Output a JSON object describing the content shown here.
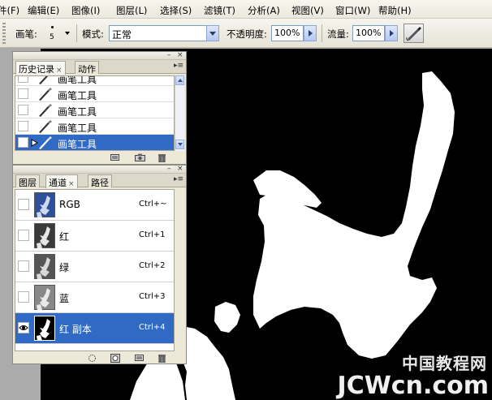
{
  "menu": {
    "items": [
      "件(F)",
      "编辑(E)",
      "图像(I)",
      "图层(L)",
      "选择(S)",
      "滤镜(T)",
      "分析(A)",
      "视图(V)",
      "窗口(W)",
      "帮助(H)"
    ]
  },
  "options": {
    "brush_label": "画笔:",
    "brush_size": "5",
    "mode_label": "模式:",
    "mode_value": "正常",
    "opacity_label": "不透明度:",
    "opacity_value": "100%",
    "flow_label": "流量:",
    "flow_value": "100%",
    "airbrush_icon": "airbrush-icon"
  },
  "history_panel": {
    "tabs": [
      "历史记录",
      "动作"
    ],
    "close_mark": "×",
    "items": [
      {
        "label": "画笔工具",
        "selected": false
      },
      {
        "label": "画笔工具",
        "selected": false
      },
      {
        "label": "画笔工具",
        "selected": false
      },
      {
        "label": "画笔工具",
        "selected": false
      },
      {
        "label": "画笔工具",
        "selected": true
      }
    ]
  },
  "channels_panel": {
    "tabs": [
      "图层",
      "通道",
      "路径"
    ],
    "close_mark": "×",
    "channels": [
      {
        "name": "RGB",
        "shortcut": "Ctrl+~",
        "visible": false,
        "selected": false
      },
      {
        "name": "红",
        "shortcut": "Ctrl+1",
        "visible": false,
        "selected": false
      },
      {
        "name": "绿",
        "shortcut": "Ctrl+2",
        "visible": false,
        "selected": false
      },
      {
        "name": "蓝",
        "shortcut": "Ctrl+3",
        "visible": false,
        "selected": false
      },
      {
        "name": "红 副本",
        "shortcut": "Ctrl+4",
        "visible": true,
        "selected": true
      }
    ]
  },
  "watermark": {
    "cn": "中国教程网",
    "en": "JCWcn.com"
  },
  "colors": {
    "selection": "#316ac5",
    "panel_bg": "#ece9d8",
    "canvas_bg": "#000000"
  }
}
